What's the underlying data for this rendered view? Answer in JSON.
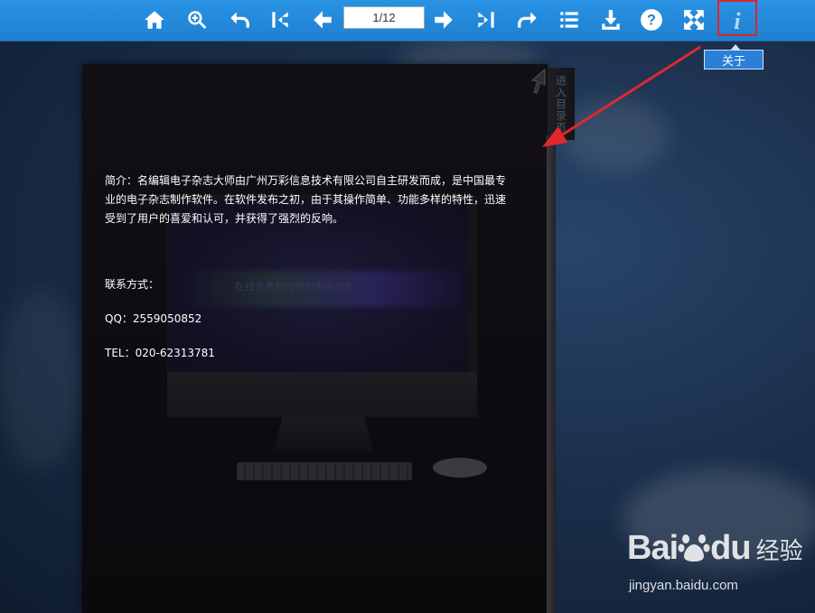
{
  "toolbar": {
    "page_indicator": "1/12",
    "icons": [
      "home-icon",
      "zoom-in-icon",
      "back-icon",
      "first-page-icon",
      "prev-page-icon",
      "next-page-icon",
      "last-page-icon",
      "forward-icon",
      "toc-icon",
      "download-icon",
      "help-icon",
      "fullscreen-icon",
      "about-icon"
    ]
  },
  "tooltip": {
    "label": "关于"
  },
  "side_tab": {
    "label": "进入目录页"
  },
  "content": {
    "intro": "简介：名编辑电子杂志大师由广州万彩信息技术有限公司自主研发而成，是中国最专业的电子杂志制作软件。在软件发布之初，由于其操作简单、功能多样的特性，迅速受到了用户的喜爱和认可，并获得了强烈的反响。",
    "contact_label": "联系方式：",
    "qq": "QQ：2559050852",
    "tel": "TEL：020-62313781",
    "screen_text": "在线免费制作你的电子杂志"
  },
  "watermark": {
    "logo": "Bai",
    "logo2": "du",
    "cn": "经验",
    "url": "jingyan.baidu.com"
  },
  "colors": {
    "toolbar": "#2088d8",
    "highlight": "#d9252a",
    "tooltip": "#2b7fd8"
  }
}
